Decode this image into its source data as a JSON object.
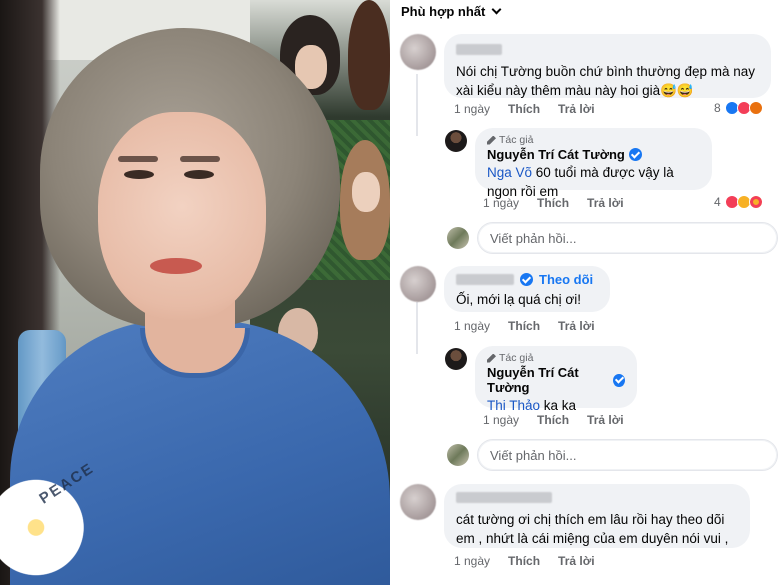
{
  "sort": {
    "label": "Phù hợp nhất"
  },
  "comments": [
    {
      "name_hidden": true,
      "text": "Nói chị Tường buồn chứ bình thường đẹp mà nay xài kiểu này thêm màu này hoi già😅😅",
      "time": "1 ngày",
      "like": "Thích",
      "reply": "Trả lời",
      "reaction_count": "8",
      "reactions": [
        "like",
        "love",
        "angry"
      ]
    },
    {
      "author_tag": "Tác giả",
      "name": "Nguyễn Trí Cát Tường",
      "mention": "Nga Võ",
      "text": " 60 tuổi mà được vậy là ngon rồi em",
      "time": "1 ngày",
      "like": "Thích",
      "reply": "Trả lời",
      "reaction_count": "4",
      "reactions": [
        "love",
        "haha",
        "care"
      ]
    },
    {
      "name_hidden": true,
      "follow": "Theo dõi",
      "text": "Ối, mới lạ quá chị ơi!",
      "time": "1 ngày",
      "like": "Thích",
      "reply": "Trả lời"
    },
    {
      "author_tag": "Tác giả",
      "name": "Nguyễn Trí Cát Tường",
      "mention": "Thi Thảo",
      "text": " ka ka",
      "time": "1 ngày",
      "like": "Thích",
      "reply": "Trả lời"
    },
    {
      "name_hidden": true,
      "text_line1": "cát tường ơi chị thích em lâu rồi hay theo dõi",
      "text_line2": "em , nhứt là cái miệng của em duyên nói vui ,",
      "time": "1 ngày",
      "like": "Thích",
      "reply": "Trả lời"
    }
  ],
  "reply_box": {
    "placeholder": "Viết phản hồi..."
  },
  "photo": {
    "shirt_text": "PEACE"
  }
}
